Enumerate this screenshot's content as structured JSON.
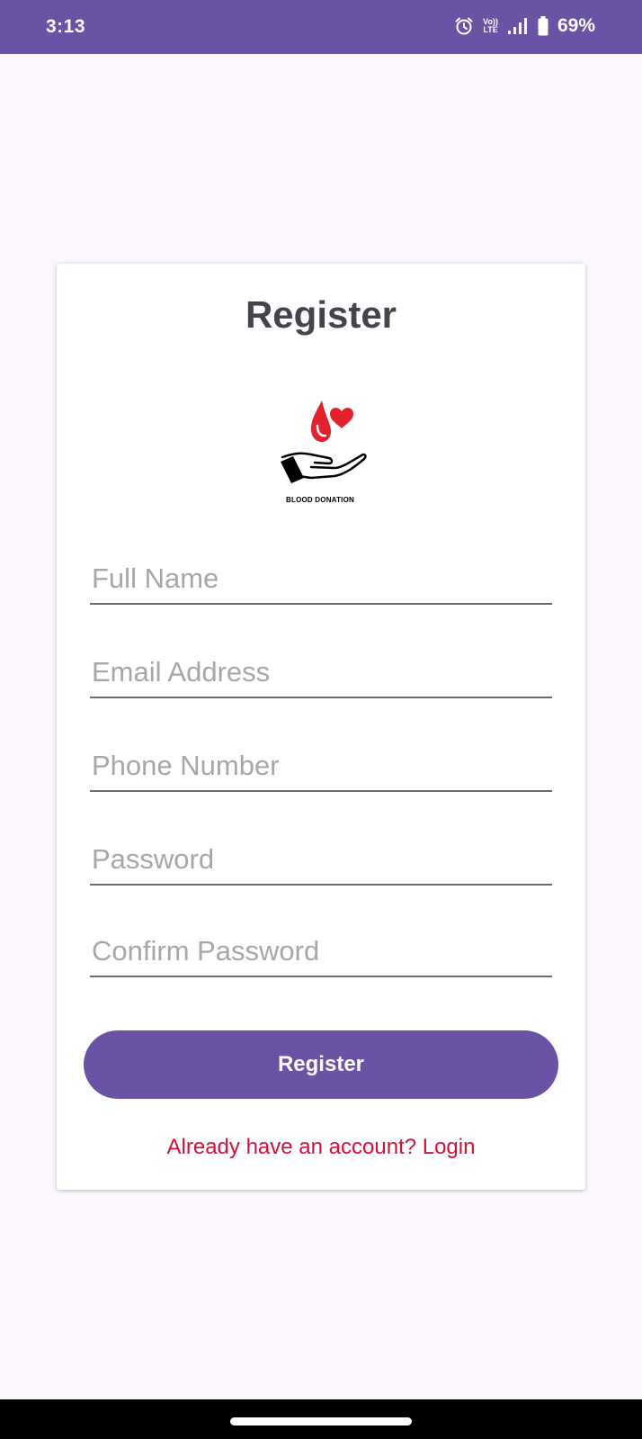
{
  "status_bar": {
    "time": "3:13",
    "volte_top": "Vo))",
    "volte_bottom": "LTE",
    "battery_percent": "69%",
    "icons": [
      "alarm-icon",
      "volte-icon",
      "signal-icon",
      "battery-icon"
    ]
  },
  "register_card": {
    "title": "Register",
    "logo_caption": "BLOOD DONATION",
    "fields": {
      "full_name_placeholder": "Full Name",
      "email_placeholder": "Email Address",
      "phone_placeholder": "Phone Number",
      "password_placeholder": "Password",
      "confirm_password_placeholder": "Confirm Password"
    },
    "register_button_label": "Register",
    "login_link": "Already have an account? Login"
  },
  "colors": {
    "primary": "#6A52A5",
    "background": "#FCF6FE",
    "card": "#FFFFFF",
    "title_text": "#45434C",
    "placeholder_text": "#A7A6AB",
    "link": "#D21139",
    "logo_red": "#E3202E"
  }
}
